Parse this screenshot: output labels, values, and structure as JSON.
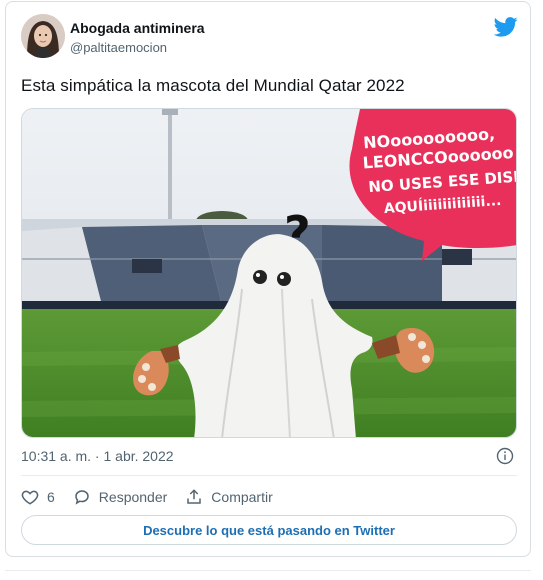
{
  "author": {
    "name": "Abogada antiminera",
    "handle": "@paltitaemocion"
  },
  "tweet": {
    "text": "Esta simpática la mascota del Mundial Qatar 2022",
    "timestamp": "10:31 a. m. · 1 abr. 2022"
  },
  "media": {
    "speech_bubble_lines": [
      "NOooooooooo,",
      "LEONCCOoooooo",
      "NO USES ESE DISFR",
      "AQUÍiiiiiiiiiiiii..."
    ],
    "question_mark": "?"
  },
  "actions": {
    "like_count": "6",
    "reply_label": "Responder",
    "share_label": "Compartir"
  },
  "cta": {
    "label": "Descubre lo que está pasando en Twitter"
  },
  "colors": {
    "twitter_blue": "#1d9bf0",
    "link_blue": "#1d6fb3",
    "bubble_pink": "#e8305a"
  },
  "icons": [
    "twitter-bird-icon",
    "info-icon",
    "heart-icon",
    "reply-icon",
    "share-icon"
  ]
}
